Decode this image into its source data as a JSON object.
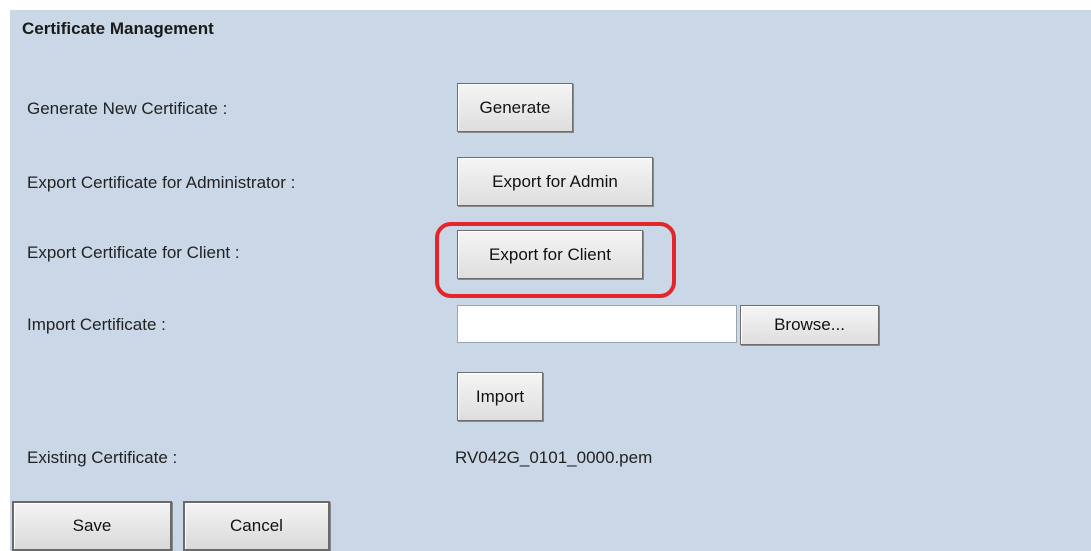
{
  "section_title": "Certificate Management",
  "rows": {
    "generate": {
      "label": "Generate New Certificate :",
      "button": "Generate"
    },
    "export_admin": {
      "label": "Export Certificate for Administrator :",
      "button": "Export for Admin"
    },
    "export_client": {
      "label": "Export Certificate for Client :",
      "button": "Export for Client"
    },
    "import": {
      "label": "Import Certificate :",
      "file_value": "",
      "browse_button": "Browse...",
      "import_button": "Import"
    },
    "existing": {
      "label": "Existing Certificate :",
      "value": "RV042G_0101_0000.pem"
    }
  },
  "footer": {
    "save_label": "Save",
    "cancel_label": "Cancel"
  },
  "colors": {
    "panel_background": "#c9d7e6",
    "highlight": "#e2262b"
  }
}
